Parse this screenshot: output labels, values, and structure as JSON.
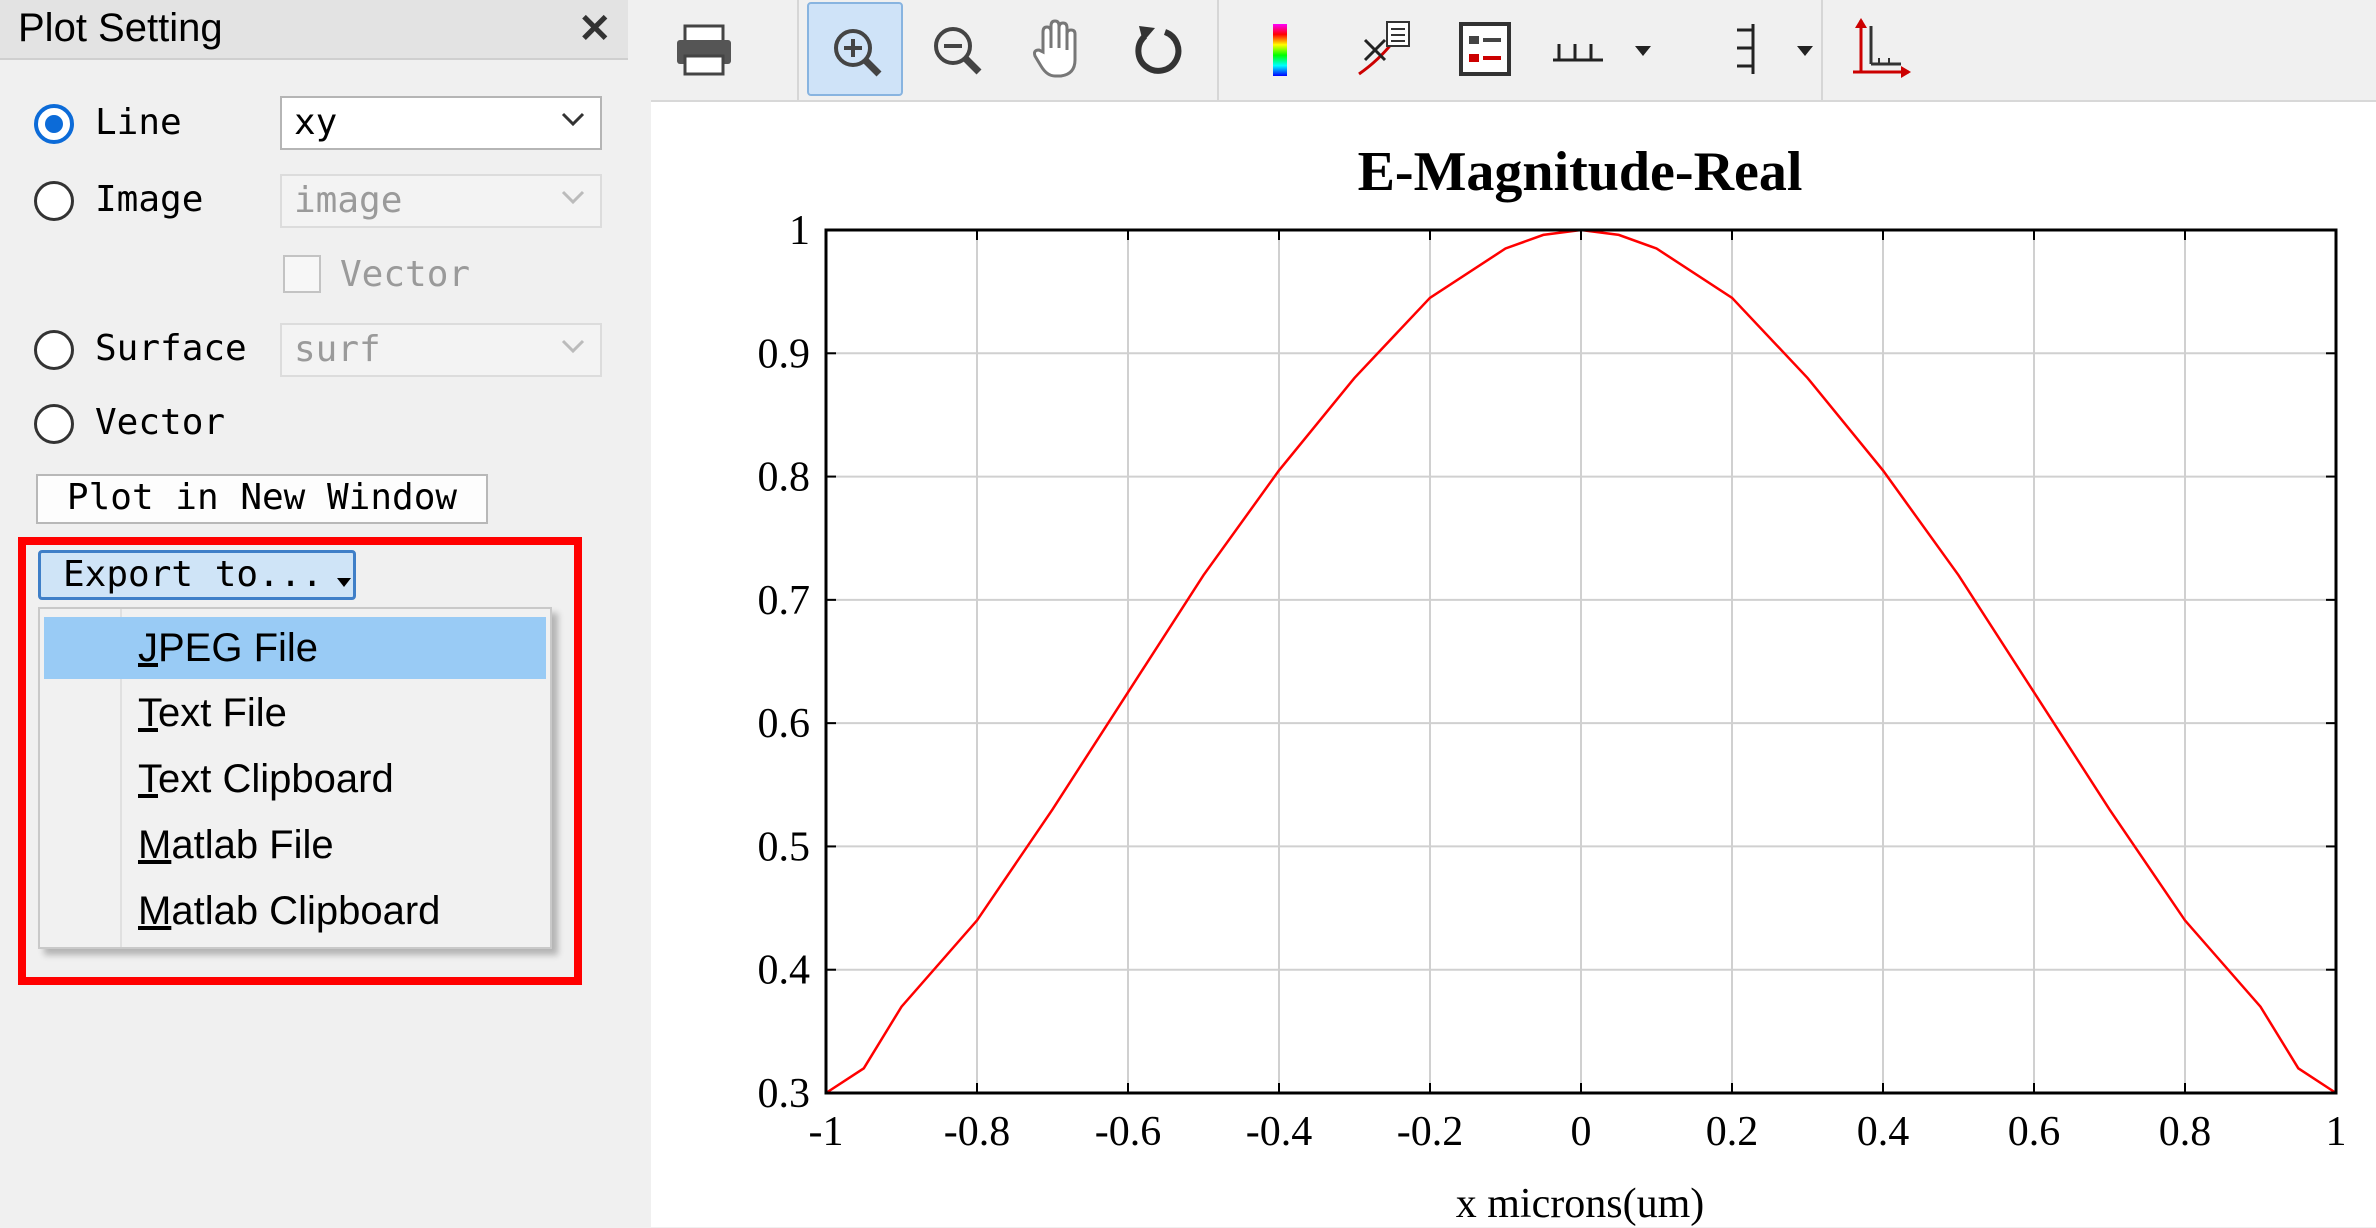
{
  "panel": {
    "title": "Plot Setting",
    "close_symbol": "✕",
    "line_label": "Line",
    "line_select_value": "xy",
    "image_label": "Image",
    "image_select_value": "image",
    "vector_checkbox_label": "Vector",
    "surface_label": "Surface",
    "surface_select_value": "surf",
    "vector_label": "Vector",
    "plot_new_window_label": "Plot in New Window",
    "export_label": "Export to...",
    "export_menu": [
      {
        "first": "J",
        "rest": "PEG File"
      },
      {
        "first": "T",
        "rest": "ext File"
      },
      {
        "first": "T",
        "rest": "ext Clipboard"
      },
      {
        "first": "M",
        "rest": "atlab File"
      },
      {
        "first": "M",
        "rest": "atlab Clipboard"
      }
    ],
    "highlighted_menu_item": "JPEG File"
  },
  "toolbar": {
    "icons": [
      "print-icon",
      "zoom-in-icon",
      "zoom-out-icon",
      "pan-hand-icon",
      "reset-icon",
      "colorbar-icon",
      "data-cursor-icon",
      "legend-icon",
      "x-ticks-icon",
      "y-ticks-icon",
      "axes-icon"
    ],
    "active": "zoom-in-icon"
  },
  "colors": {
    "curve": "#ff0000",
    "highlight_box": "#ff0000",
    "menu_highlight": "#99cbf5",
    "radio_checked": "#0c6bd8"
  },
  "chart_data": {
    "type": "line",
    "title": "E-Magnitude-Real",
    "xlabel": "x microns(um)",
    "ylabel": "",
    "xlim": [
      -1,
      1
    ],
    "ylim": [
      0.3,
      1
    ],
    "xticks": [
      "-1",
      "-0.8",
      "-0.6",
      "-0.4",
      "-0.2",
      "0",
      "0.2",
      "0.4",
      "0.6",
      "0.8",
      "1"
    ],
    "yticks": [
      "0.3",
      "0.4",
      "0.5",
      "0.6",
      "0.7",
      "0.8",
      "0.9",
      "1"
    ],
    "grid": true,
    "series": [
      {
        "color": "#ff0000",
        "x": [
          -1,
          -0.95,
          -0.9,
          -0.8,
          -0.7,
          -0.6,
          -0.5,
          -0.4,
          -0.3,
          -0.2,
          -0.1,
          -0.05,
          0,
          0.05,
          0.1,
          0.2,
          0.3,
          0.4,
          0.5,
          0.6,
          0.7,
          0.8,
          0.9,
          0.95,
          1
        ],
        "y": [
          0.3,
          0.32,
          0.37,
          0.44,
          0.53,
          0.625,
          0.72,
          0.805,
          0.88,
          0.945,
          0.985,
          0.996,
          1.0,
          0.996,
          0.985,
          0.945,
          0.88,
          0.805,
          0.72,
          0.625,
          0.53,
          0.44,
          0.37,
          0.32,
          0.3
        ]
      }
    ]
  }
}
